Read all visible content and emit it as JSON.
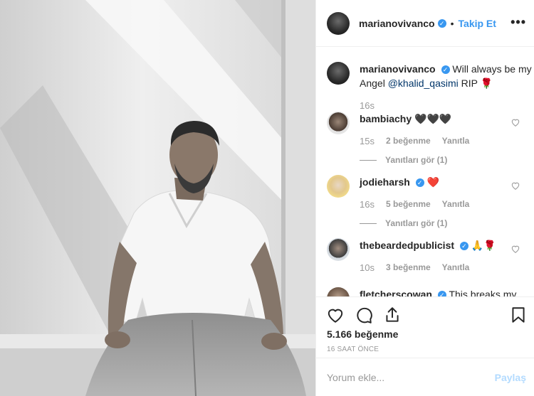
{
  "header": {
    "username": "marianovivanco",
    "separator": "•",
    "follow_label": "Takip Et",
    "more_label": "•••"
  },
  "caption": {
    "username": "marianovivanco",
    "text_before": "Will always be my Angel ",
    "mention": "@khalid_qasimi",
    "text_after": " RIP 🌹",
    "time": "16s"
  },
  "comments": [
    {
      "username": "bambiachy",
      "verified": false,
      "text": "🖤🖤🖤",
      "time": "15s",
      "likes": "2 beğenme",
      "reply": "Yanıtla",
      "view_replies": "Yanıtları gör (1)"
    },
    {
      "username": "jodieharsh",
      "verified": true,
      "text": "❤️",
      "time": "16s",
      "likes": "5 beğenme",
      "reply": "Yanıtla",
      "view_replies": "Yanıtları gör (1)"
    },
    {
      "username": "thebeardedpublicist",
      "verified": true,
      "text": "🙏🌹",
      "time": "10s",
      "likes": "3 beğenme",
      "reply": "Yanıtla"
    },
    {
      "username": "fletcherscowan",
      "verified": true,
      "text": "This breaks my"
    }
  ],
  "actions": {
    "likes_count": "5.166 beğenme",
    "time_ago": "16 SAAT ÖNCE"
  },
  "add_comment": {
    "placeholder": "Yorum ekle...",
    "post_label": "Paylaş"
  },
  "colors": {
    "accent": "#3897f0",
    "muted": "#999999",
    "mention": "#003569"
  }
}
